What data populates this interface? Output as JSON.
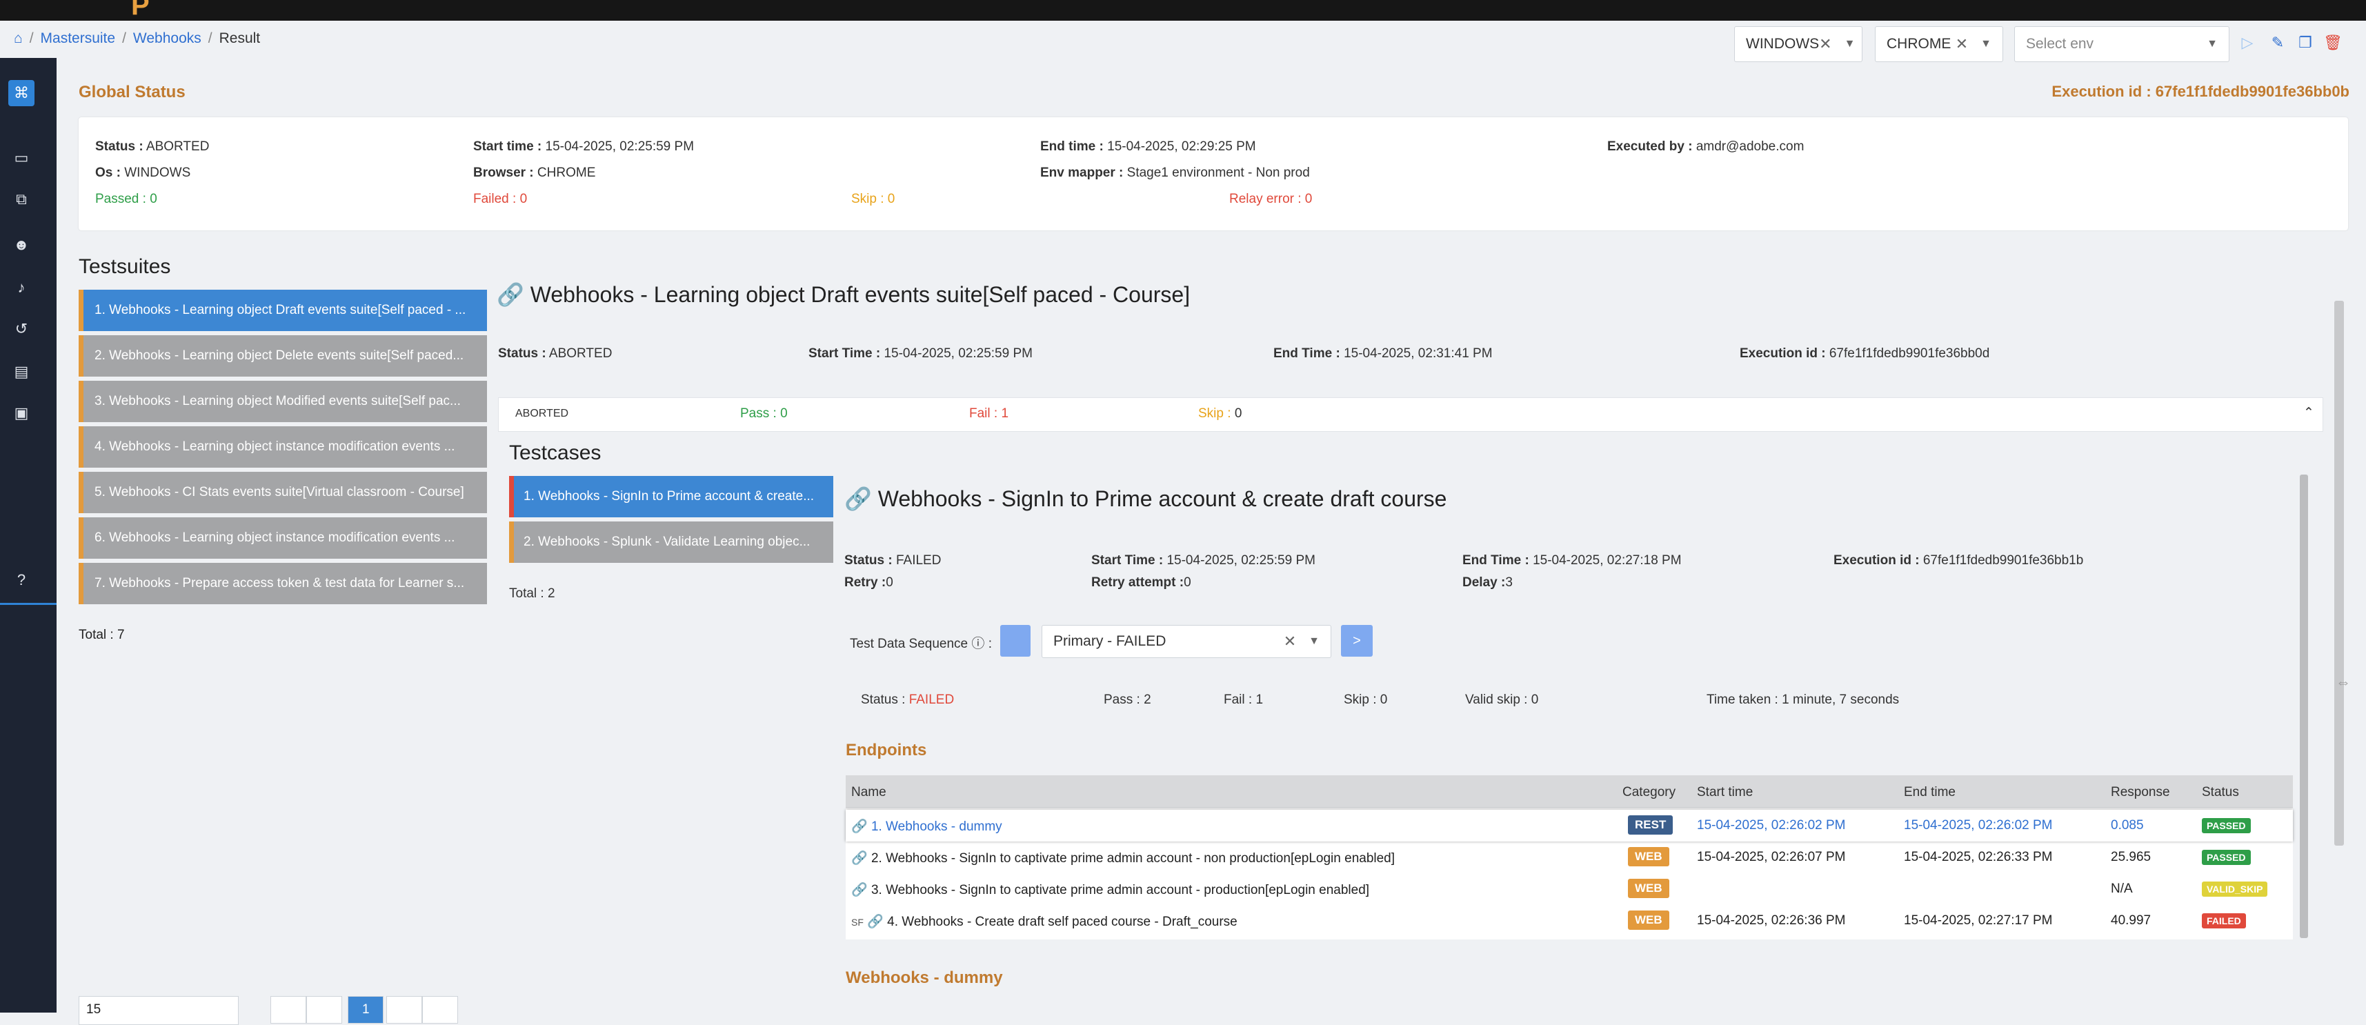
{
  "colors": {
    "accent": "#3d87d3",
    "brand_orange": "#c07a2f",
    "passed": "#2e9e48",
    "failed": "#e0493b",
    "skip": "#e8a31a",
    "nav_bg": "#1d2433"
  },
  "breadcrumb": {
    "home_icon": "home-icon",
    "items": [
      "Mastersuite",
      "Webhooks",
      "Result"
    ],
    "sep": "/"
  },
  "header": {
    "os_select": {
      "value": "WINDOWS"
    },
    "browser_select": {
      "value": "CHROME"
    },
    "env_select": {
      "placeholder": "Select env"
    },
    "icons": [
      "play-icon",
      "edit-icon",
      "copy-icon",
      "delete-icon"
    ]
  },
  "global": {
    "title": "Global Status",
    "execution_id": "Execution id : 67fe1f1fdedb9901fe36bb0b",
    "status_label": "Status :",
    "status": "ABORTED",
    "os_label": "Os :",
    "os": "WINDOWS",
    "passed": "Passed : 0",
    "start_label": "Start time :",
    "start": "15-04-2025, 02:25:59 PM",
    "browser_label": "Browser :",
    "browser": "CHROME",
    "failed": "Failed : 0",
    "skip": "Skip : 0",
    "end_label": "End time :",
    "end": "15-04-2025, 02:29:25 PM",
    "env_label": "Env mapper :",
    "env": "Stage1 environment - Non prod",
    "relay": "Relay error : 0",
    "executed_label": "Executed by :",
    "executed": "amdr@adobe.com"
  },
  "testsuites": {
    "title": "Testsuites",
    "items": [
      "1. Webhooks - Learning object Draft events suite[Self paced - ...",
      "2. Webhooks - Learning object Delete events suite[Self paced...",
      "3. Webhooks - Learning object Modified events suite[Self pac...",
      "4. Webhooks - Learning object instance modification events ...",
      "5. Webhooks - CI Stats events suite[Virtual classroom - Course]",
      "6. Webhooks - Learning object instance modification events ...",
      "7. Webhooks - Prepare access token & test data for Learner s..."
    ],
    "total": "Total : 7"
  },
  "suite_detail": {
    "title": "Webhooks - Learning object Draft events suite[Self paced - Course]",
    "status_label": "Status :",
    "status": "ABORTED",
    "start_label": "Start Time :",
    "start": "15-04-2025, 02:25:59 PM",
    "end_label": "End Time :",
    "end": "15-04-2025, 02:31:41 PM",
    "exec_label": "Execution id :",
    "exec": "67fe1f1fdedb9901fe36bb0d",
    "summary_status": "ABORTED",
    "pass_label": "Pass :",
    "pass": "0",
    "fail_label": "Fail :",
    "fail": "1",
    "skip_label": "Skip :",
    "skip": "0"
  },
  "testcases": {
    "title": "Testcases",
    "items": [
      "1. Webhooks - SignIn to Prime account & create...",
      "2. Webhooks - Splunk - Validate Learning objec..."
    ],
    "total": "Total : 2"
  },
  "tc_detail": {
    "title": "Webhooks - SignIn to Prime account & create draft course",
    "status_label": "Status :",
    "status": "FAILED",
    "retry_label": "Retry :",
    "retry": "0",
    "start_label": "Start Time :",
    "start": "15-04-2025, 02:25:59 PM",
    "retry_attempt_label": "Retry attempt :",
    "retry_attempt": "0",
    "end_label": "End Time :",
    "end": "15-04-2025, 02:27:18 PM",
    "delay_label": "Delay :",
    "delay": "3",
    "exec_label": "Execution id :",
    "exec": "67fe1f1fdedb9901fe36bb1b",
    "tds_label": "Test Data Sequence",
    "tds_value": "Primary - FAILED",
    "next": ">",
    "run_status_label": "Status :",
    "run_status": "FAILED",
    "pass": "Pass : 2",
    "fail": "Fail : 1",
    "skip": "Skip : 0",
    "valid_skip": "Valid skip : 0",
    "time": "Time taken : 1 minute, 7 seconds"
  },
  "endpoints": {
    "title": "Endpoints",
    "headers": [
      "Name",
      "Category",
      "Start time",
      "End time",
      "Response",
      "Status"
    ],
    "rows": [
      {
        "name": "1. Webhooks - dummy",
        "category": "REST",
        "start": "15-04-2025, 02:26:02 PM",
        "end": "15-04-2025, 02:26:02 PM",
        "response": "0.085",
        "status": "PASSED",
        "prefix": ""
      },
      {
        "name": "2. Webhooks - SignIn to captivate prime admin account - non production[epLogin enabled]",
        "category": "WEB",
        "start": "15-04-2025, 02:26:07 PM",
        "end": "15-04-2025, 02:26:33 PM",
        "response": "25.965",
        "status": "PASSED",
        "prefix": ""
      },
      {
        "name": "3. Webhooks - SignIn to captivate prime admin account - production[epLogin enabled]",
        "category": "WEB",
        "start": "",
        "end": "",
        "response": "N/A",
        "status": "VALID_SKIP",
        "prefix": ""
      },
      {
        "name": "4. Webhooks - Create draft self paced course - Draft_course",
        "category": "WEB",
        "start": "15-04-2025, 02:26:36 PM",
        "end": "15-04-2025, 02:27:17 PM",
        "response": "40.997",
        "status": "FAILED",
        "prefix": "SF"
      }
    ],
    "next_title": "Webhooks - dummy"
  },
  "pagination": {
    "page_size": "15",
    "current": "1"
  }
}
